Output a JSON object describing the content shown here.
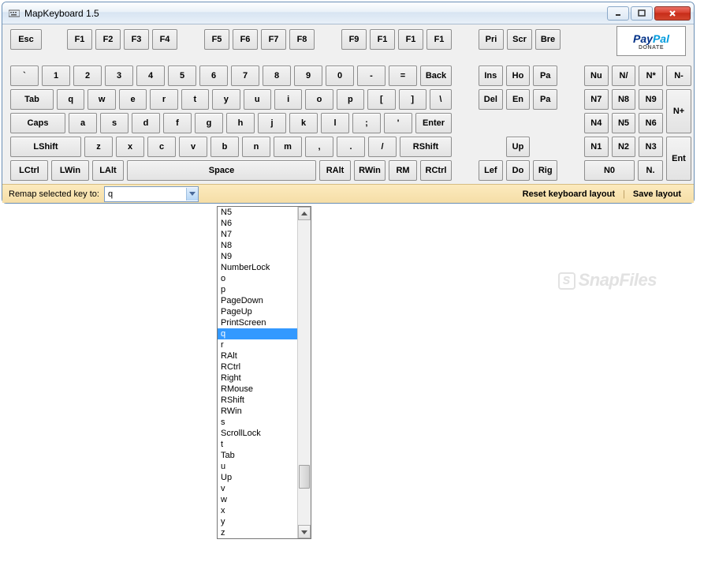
{
  "window": {
    "title": "MapKeyboard 1.5"
  },
  "paypal": {
    "pay": "Pay",
    "pal": "Pal",
    "donate": "DONATE"
  },
  "row_fn": {
    "esc": "Esc",
    "g1": [
      "F1",
      "F2",
      "F3",
      "F4"
    ],
    "g2": [
      "F5",
      "F6",
      "F7",
      "F8"
    ],
    "g3": [
      "F9",
      "F1",
      "F1",
      "F1"
    ],
    "g4": [
      "Pri",
      "Scr",
      "Bre"
    ]
  },
  "row_num": {
    "tilde": "`",
    "digits": [
      "1",
      "2",
      "3",
      "4",
      "5",
      "6",
      "7",
      "8",
      "9",
      "0",
      "-",
      "="
    ],
    "back": "Back",
    "nav": [
      "Ins",
      "Ho",
      "Pa"
    ],
    "np": [
      "Nu",
      "N/",
      "N*"
    ],
    "nminus": "N-"
  },
  "row_q": {
    "tab": "Tab",
    "letters": [
      "q",
      "w",
      "e",
      "r",
      "t",
      "y",
      "u",
      "i",
      "o",
      "p",
      "[",
      "]"
    ],
    "bslash": "\\",
    "nav": [
      "Del",
      "En",
      "Pa"
    ],
    "np": [
      "N7",
      "N8",
      "N9"
    ],
    "nplus": "N+"
  },
  "row_a": {
    "caps": "Caps",
    "letters": [
      "a",
      "s",
      "d",
      "f",
      "g",
      "h",
      "j",
      "k",
      "l",
      ";",
      "'"
    ],
    "enter": "Enter",
    "np": [
      "N4",
      "N5",
      "N6"
    ]
  },
  "row_z": {
    "lshift": "LShift",
    "letters": [
      "z",
      "x",
      "c",
      "v",
      "b",
      "n",
      "m",
      ",",
      ".",
      "/"
    ],
    "rshift": "RShift",
    "up": "Up",
    "np": [
      "N1",
      "N2",
      "N3"
    ],
    "ent": "Ent"
  },
  "row_sp": {
    "mods_l": [
      "LCtrl",
      "LWin",
      "LAlt"
    ],
    "space": "Space",
    "mods_r": [
      "RAlt",
      "RWin",
      "RM",
      "RCtrl"
    ],
    "arrows": [
      "Lef",
      "Do",
      "Rig"
    ],
    "np": [
      "N0",
      "N."
    ]
  },
  "remap": {
    "label": "Remap selected key to:",
    "value": "q",
    "reset": "Reset keyboard layout",
    "save": "Save layout"
  },
  "dropdown": {
    "selected": "q",
    "items": [
      "N5",
      "N6",
      "N7",
      "N8",
      "N9",
      "NumberLock",
      "o",
      "p",
      "PageDown",
      "PageUp",
      "PrintScreen",
      "q",
      "r",
      "RAlt",
      "RCtrl",
      "Right",
      "RMouse",
      "RShift",
      "RWin",
      "s",
      "ScrollLock",
      "t",
      "Tab",
      "u",
      "Up",
      "v",
      "w",
      "x",
      "y",
      "z"
    ]
  },
  "watermark": "SnapFiles"
}
